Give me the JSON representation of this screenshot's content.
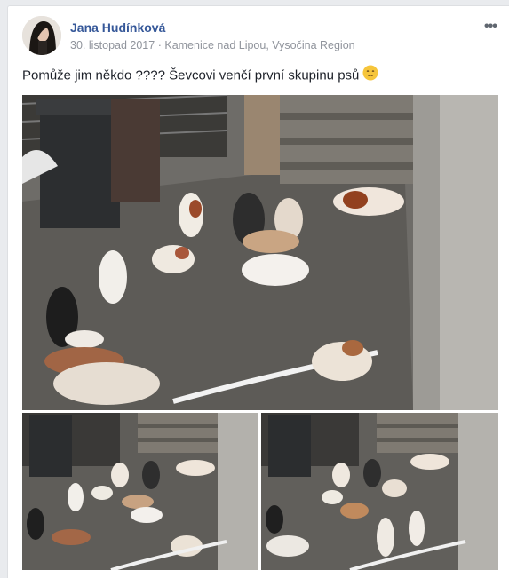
{
  "post": {
    "author": "Jana Hudínková",
    "date": "30. listopad 2017",
    "separator": "·",
    "location": "Kamenice nad Lipou, Vysočina Region",
    "text": "Pomůže jim někdo ???? Ševcovi venčí první skupinu psů",
    "more_glyph": "•••"
  },
  "icons": {
    "options": "more-options-icon",
    "emoji": "disappointed-face-emoji-icon"
  },
  "photos": [
    {
      "name": "main-photo",
      "subject": "group of small dogs in a courtyard"
    },
    {
      "name": "thumbnail-1",
      "subject": "dogs in courtyard"
    },
    {
      "name": "thumbnail-2",
      "subject": "dogs in courtyard"
    }
  ],
  "colors": {
    "author_link": "#365899",
    "meta": "#90949c",
    "text": "#1d2129",
    "page_bg": "#e9ebee"
  }
}
